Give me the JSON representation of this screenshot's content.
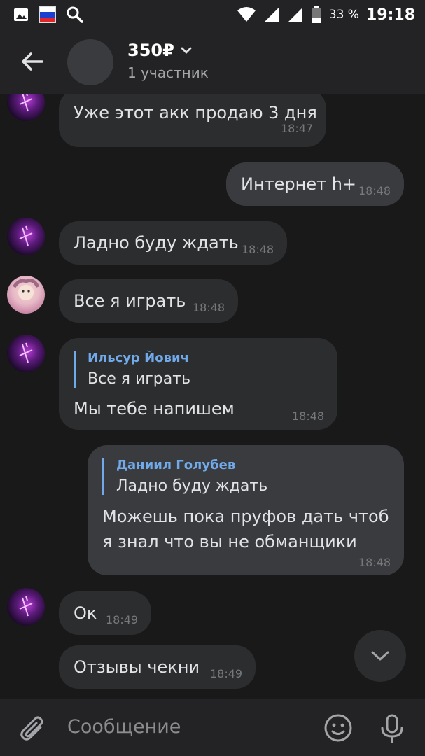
{
  "status_bar": {
    "battery_percent": "33 %",
    "time": "19:18"
  },
  "header": {
    "title": "350₽",
    "subtitle": "1 участник"
  },
  "messages": [
    {
      "text": "Уже этот акк продаю 3 дня",
      "time": "18:47"
    },
    {
      "text": "Интернет h+",
      "time": "18:48"
    },
    {
      "text": "Ладно буду ждать",
      "time": "18:48"
    },
    {
      "text": "Все я играть",
      "time": "18:48"
    },
    {
      "reply_name": "Ильсур Йович",
      "reply_text": "Все я играть",
      "text": "Мы тебе напишем",
      "time": "18:48"
    },
    {
      "reply_name": "Даниил Голубев",
      "reply_text": "Ладно буду ждать",
      "line1": "Можешь пока пруфов дать чтоб",
      "line2": "я знал что вы не обманщики",
      "time": "18:48"
    },
    {
      "text": "Ок",
      "time": "18:49"
    },
    {
      "text": "Отзывы чекни",
      "time": "18:49"
    }
  ],
  "composer": {
    "placeholder": "Сообщение"
  },
  "colors": {
    "background": "#19191a",
    "bar": "#232325",
    "bubble_in": "#2c2d2e",
    "bubble_out": "#3a3b3e",
    "accent": "#71aaeb"
  }
}
